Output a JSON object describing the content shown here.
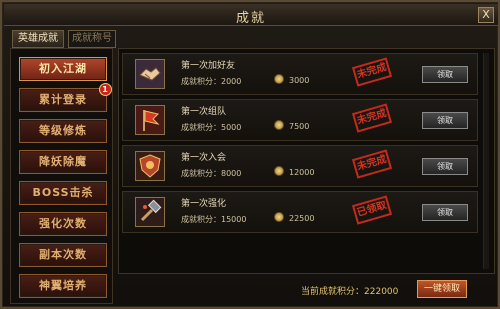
{
  "window": {
    "title": "成就",
    "close_label": "X"
  },
  "tabs": [
    {
      "label": "英雄成就",
      "active": true
    },
    {
      "label": "成就称号",
      "active": false
    }
  ],
  "sidebar": {
    "items": [
      {
        "label": "初入江湖",
        "selected": true
      },
      {
        "label": "累计登录",
        "badge": "1"
      },
      {
        "label": "等级修炼"
      },
      {
        "label": "降妖除魔"
      },
      {
        "label": "BOSS击杀"
      },
      {
        "label": "强化次数"
      },
      {
        "label": "副本次数"
      },
      {
        "label": "神翼培养"
      }
    ]
  },
  "achievements": [
    {
      "name": "第一次加好友",
      "score_label": "成就积分：",
      "score": "2000",
      "reward": "3000",
      "status": "未完成",
      "button_label": "领取",
      "icon": "handshake-icon"
    },
    {
      "name": "第一次组队",
      "score_label": "成就积分：",
      "score": "5000",
      "reward": "7500",
      "status": "未完成",
      "button_label": "领取",
      "icon": "team-banner-icon"
    },
    {
      "name": "第一次入会",
      "score_label": "成就积分：",
      "score": "8000",
      "reward": "12000",
      "status": "未完成",
      "button_label": "领取",
      "icon": "guild-shield-icon"
    },
    {
      "name": "第一次强化",
      "score_label": "成就积分：",
      "score": "15000",
      "reward": "22500",
      "status": "已领取",
      "button_label": "领取",
      "icon": "enhance-hammer-icon"
    }
  ],
  "footer": {
    "total_label": "当前成就积分：",
    "total_value": "222000",
    "claim_all_label": "一键领取"
  },
  "colors": {
    "accent": "#b3462a",
    "stamp_red": "#c22a1c",
    "gold_text": "#e2c36e"
  }
}
